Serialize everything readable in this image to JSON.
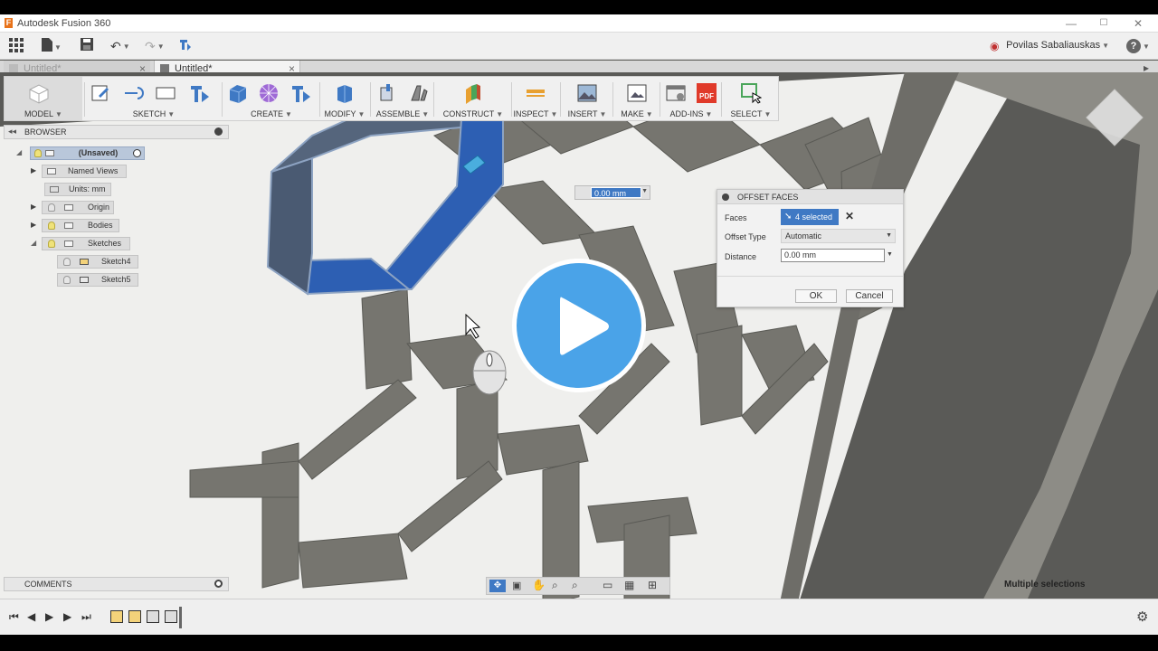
{
  "window": {
    "title": "Autodesk Fusion 360",
    "min": "—",
    "max": "☐",
    "close": "✕"
  },
  "appbar": {
    "user": "Povilas Sabaliauskas",
    "help": "?",
    "record": "◉"
  },
  "tabs": [
    {
      "label": "Untitled*",
      "close": "×",
      "active": false
    },
    {
      "label": "Untitled*",
      "close": "×",
      "active": true
    }
  ],
  "toolbar": {
    "model": "MODEL",
    "sketch": "SKETCH",
    "create": "CREATE",
    "modify": "MODIFY",
    "assemble": "ASSEMBLE",
    "construct": "CONSTRUCT",
    "inspect": "INSPECT",
    "insert": "INSERT",
    "make": "MAKE",
    "addins": "ADD-INS",
    "select": "SELECT"
  },
  "browser": {
    "header": "BROWSER",
    "root": "(Unsaved)",
    "items": [
      "Named Views",
      "Units: mm",
      "Origin",
      "Bodies",
      "Sketches",
      "Sketch4",
      "Sketch5"
    ]
  },
  "heads_up": {
    "value": "0.00 mm"
  },
  "dialog": {
    "title": "OFFSET FACES",
    "faces_label": "Faces",
    "faces_value": "4 selected",
    "offset_type_label": "Offset Type",
    "offset_type_value": "Automatic",
    "distance_label": "Distance",
    "distance_value": "0.00 mm",
    "ok": "OK",
    "cancel": "Cancel"
  },
  "comments": {
    "label": "COMMENTS"
  },
  "status": {
    "text": "Multiple selections"
  },
  "colors": {
    "accent": "#3f79c4",
    "play": "#4aa3e8",
    "selection": "#2d5fb3"
  }
}
